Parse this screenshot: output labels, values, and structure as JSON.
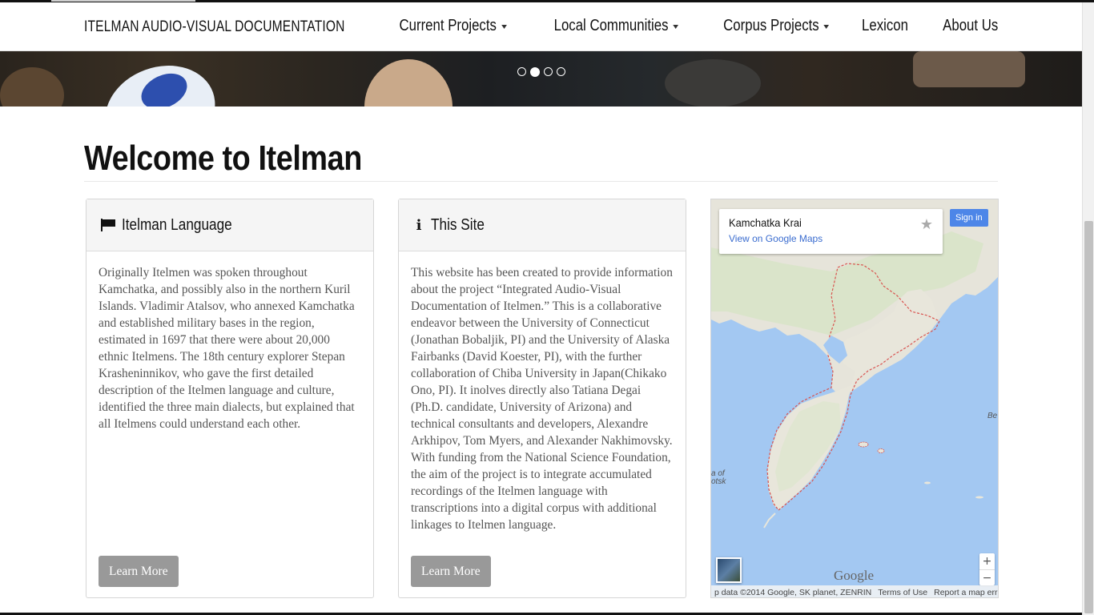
{
  "navbar": {
    "brand": "ITELMAN AUDIO-VISUAL DOCUMENTATION",
    "items": [
      {
        "label": "Current Projects",
        "dropdown": true
      },
      {
        "label": "Local Communities",
        "dropdown": true
      },
      {
        "label": "Corpus Projects",
        "dropdown": true
      },
      {
        "label": "Lexicon",
        "dropdown": false
      },
      {
        "label": "About Us",
        "dropdown": false
      }
    ]
  },
  "carousel": {
    "slide_count": 4,
    "active_index": 1
  },
  "main": {
    "title": "Welcome to Itelman"
  },
  "panels": {
    "language": {
      "icon": "flag-icon",
      "title": "Itelman Language",
      "body": "Originally Itelmen was spoken throughout Kamchatka, and possibly also in the northern Kuril Islands. Vladimir Atalsov, who annexed Kamchatka and established military bases in the region, estimated in 1697 that there were about 20,000 ethnic Itelmens. The 18th century explorer Stepan Krasheninnikov, who gave the first detailed description of the Itelmen language and culture, identified the three main dialects, but explained that all Itelmens could understand each other.",
      "button": "Learn More"
    },
    "site": {
      "icon": "info-icon",
      "title": "This Site",
      "body": "This website has been created to provide information about the project “Integrated Audio-Visual Documentation of Itelmen.” This is a collaborative endeavor between the University of Connecticut (Jonathan Bobaljik, PI) and the University of Alaska Fairbanks (David Koester, PI), with the further collaboration of Chiba University in Japan(Chikako Ono, PI). It inolves directly also Tatiana Degai (Ph.D. candidate, University of Arizona) and technical consultants and developers, Alexandre Arkhipov, Tom Myers, and Alexander Nakhimovsky. With funding from the National Science Foundation, the aim of the project is to integrate accumulated recordings of the Itelmen language with transcriptions into a digital corpus with additional linkages to Itelmen language.",
      "button": "Learn More"
    }
  },
  "map": {
    "place_name": "Kamchatka Krai",
    "view_link": "View on Google Maps",
    "sign_in": "Sign in",
    "zoom_in": "+",
    "zoom_out": "−",
    "logo": "Google",
    "label_sea_left": "a of\notsk",
    "label_sea_right": "Be",
    "footer": {
      "map_data": "p data ©2014 Google, SK planet, ZENRIN",
      "terms": "Terms of Use",
      "report": "Report a map error"
    },
    "colors": {
      "water": "#a3c8f2",
      "land": "#e9e5dc",
      "boundary": "#d9534f"
    }
  }
}
